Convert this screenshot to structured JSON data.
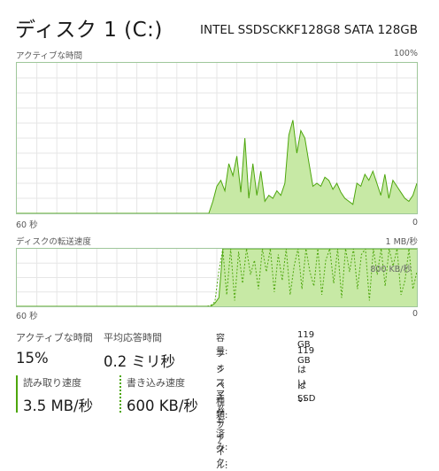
{
  "header": {
    "title": "ディスク 1 (C:)",
    "model": "INTEL SSDSCKKF128G8 SATA 128GB"
  },
  "active_graph": {
    "label": "アクティブな時間",
    "max_label": "100%",
    "left_label": "60 秒",
    "right_label": "0",
    "values": [
      0,
      0,
      0,
      0,
      0,
      0,
      0,
      0,
      0,
      0,
      0,
      0,
      0,
      0,
      0,
      0,
      0,
      0,
      0,
      0,
      0,
      0,
      0,
      0,
      0,
      0,
      0,
      0,
      0,
      0,
      0,
      0,
      0,
      0,
      0,
      0,
      0,
      0,
      0,
      0,
      0,
      0,
      0,
      0,
      0,
      0,
      0,
      0,
      0,
      8,
      18,
      22,
      15,
      33,
      25,
      38,
      14,
      50,
      10,
      33,
      12,
      28,
      8,
      12,
      10,
      15,
      12,
      20,
      52,
      62,
      40,
      55,
      50,
      34,
      18,
      20,
      18,
      24,
      22,
      16,
      20,
      14,
      10,
      8,
      6,
      20,
      18,
      26,
      22,
      28,
      20,
      12,
      26,
      10,
      22,
      18,
      14,
      10,
      8,
      12,
      20
    ]
  },
  "transfer_graph": {
    "label": "ディスクの転送速度",
    "max_label": "1 MB/秒",
    "mid_label": "800 KB/秒",
    "left_label": "60 秒",
    "right_label": "0",
    "read_values": [
      0,
      0,
      0,
      0,
      0,
      0,
      0,
      0,
      0,
      0,
      0,
      0,
      0,
      0,
      0,
      0,
      0,
      0,
      0,
      0,
      0,
      0,
      0,
      0,
      0,
      0,
      0,
      0,
      0,
      0,
      0,
      0,
      0,
      0,
      0,
      0,
      0,
      0,
      0,
      0,
      0,
      0,
      0,
      0,
      0,
      0,
      0,
      0,
      0,
      5,
      15,
      100,
      100,
      100,
      100,
      100,
      100,
      100,
      100,
      100,
      100,
      100,
      100,
      100,
      100,
      100,
      100,
      100,
      100,
      100,
      100,
      100,
      100,
      100,
      100,
      100,
      100,
      100,
      100,
      100,
      100,
      100,
      100,
      100,
      100,
      100,
      100,
      100,
      100,
      100,
      100,
      100,
      100,
      100,
      100,
      100,
      100,
      100,
      100,
      100
    ],
    "write_values": [
      0,
      0,
      0,
      0,
      0,
      0,
      0,
      0,
      0,
      0,
      0,
      0,
      0,
      0,
      0,
      0,
      0,
      0,
      0,
      0,
      0,
      0,
      0,
      0,
      0,
      0,
      0,
      0,
      0,
      0,
      0,
      0,
      0,
      0,
      0,
      0,
      0,
      0,
      0,
      0,
      0,
      0,
      0,
      0,
      0,
      0,
      0,
      0,
      0,
      2,
      8,
      60,
      100,
      20,
      100,
      10,
      95,
      40,
      100,
      55,
      80,
      30,
      100,
      60,
      100,
      25,
      90,
      45,
      100,
      20,
      70,
      100,
      30,
      100,
      60,
      35,
      100,
      20,
      80,
      100,
      40,
      100,
      15,
      100,
      60,
      100,
      30,
      90,
      100,
      10,
      100,
      55,
      100,
      35,
      100,
      70,
      100,
      20,
      45,
      100,
      30,
      60
    ]
  },
  "stats": {
    "active_time_label": "アクティブな時間",
    "active_time_value": "15%",
    "response_label": "平均応答時間",
    "response_value": "0.2 ミリ秒",
    "read_label": "読み取り速度",
    "read_value": "3.5 MB/秒",
    "write_label": "書き込み速度",
    "write_value": "600 KB/秒"
  },
  "info": [
    {
      "label": "容量:",
      "value": "119 GB"
    },
    {
      "label": "フォーマット済み:",
      "value": "119 GB"
    },
    {
      "label": "システム ディスク:",
      "value": "はい"
    },
    {
      "label": "ページ ファイル:",
      "value": "はい"
    },
    {
      "label": "種類:",
      "value": "SSD"
    }
  ],
  "colors": {
    "accent": "#4da60c",
    "fill": "#c7e9a5",
    "border": "#9fc79a",
    "grid": "#e6e6e6"
  }
}
